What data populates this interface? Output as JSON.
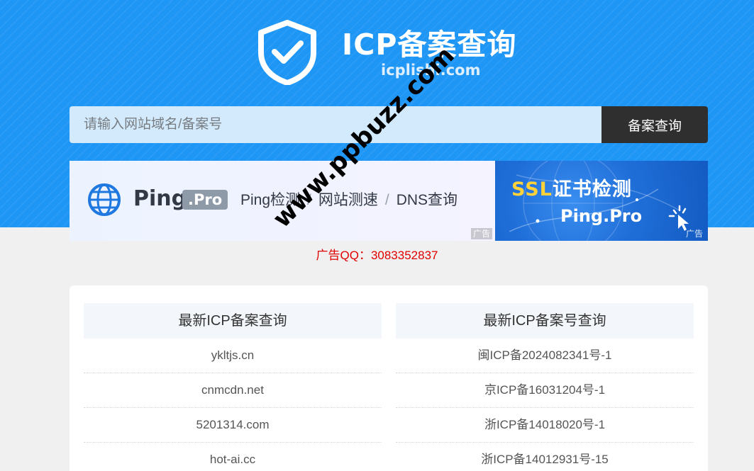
{
  "header": {
    "title": "ICP备案查询",
    "domain": "icplishi.com"
  },
  "search": {
    "placeholder": "请输入网站域名/备案号",
    "button_label": "备案查询"
  },
  "ads": {
    "left": {
      "brand": "Ping",
      "brand_suffix": ".Pro",
      "links": [
        "Ping检测",
        "网站测速",
        "DNS查询"
      ],
      "tag": "广告"
    },
    "right": {
      "title_em": "SSL",
      "title_rest": "证书检测",
      "subtitle": "Ping.Pro",
      "tag": "广告"
    },
    "contact": "广告QQ：3083352837"
  },
  "latest": {
    "domains_header": "最新ICP备案查询",
    "numbers_header": "最新ICP备案号查询",
    "domains": [
      "ykltjs.cn",
      "cnmcdn.net",
      "5201314.com",
      "hot-ai.cc"
    ],
    "numbers": [
      "闽ICP备2024082341号-1",
      "京ICP备16031204号-1",
      "浙ICP备14018020号-1",
      "浙ICP备14012931号-15"
    ]
  },
  "watermark": "www.ppbuzz.com",
  "colors": {
    "hero_blue": "#1e96f6",
    "search_button": "#2f2f2f",
    "contact_red": "#e00000"
  }
}
